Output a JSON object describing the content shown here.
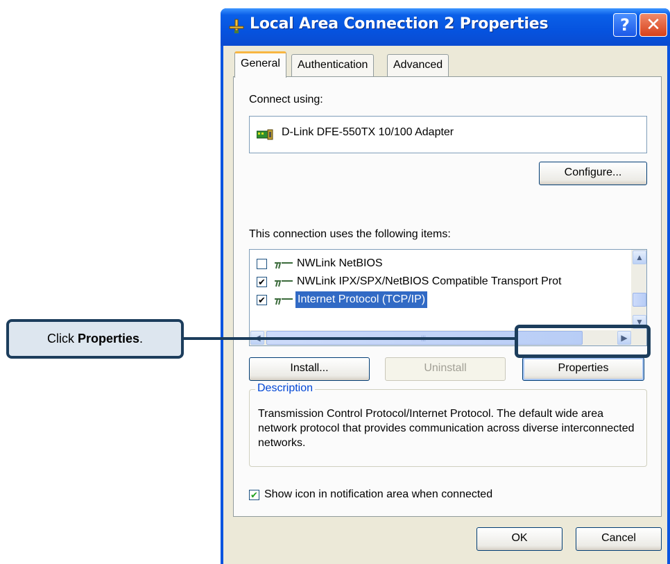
{
  "window": {
    "title": "Local Area Connection 2 Properties",
    "help_label": "?",
    "close_label": "✕"
  },
  "tabs": [
    {
      "label": "General",
      "active": true
    },
    {
      "label": "Authentication",
      "active": false
    },
    {
      "label": "Advanced",
      "active": false
    }
  ],
  "general": {
    "connect_using_label": "Connect using:",
    "adapter_name": "D-Link DFE-550TX 10/100 Adapter",
    "configure_label": "Configure...",
    "items_label": "This connection uses the following items:",
    "items": [
      {
        "label": "NWLink NetBIOS",
        "checked": false,
        "selected": false
      },
      {
        "label": "NWLink IPX/SPX/NetBIOS Compatible Transport Prot",
        "checked": true,
        "selected": false
      },
      {
        "label": "Internet Protocol (TCP/IP)",
        "checked": true,
        "selected": true
      }
    ],
    "install_label": "Install...",
    "uninstall_label": "Uninstall",
    "properties_label": "Properties",
    "description_title": "Description",
    "description_text": "Transmission Control Protocol/Internet Protocol. The default wide area network protocol that provides communication across diverse interconnected networks.",
    "show_icon_label": "Show icon in notification area when connected",
    "show_icon_checked": true
  },
  "footer": {
    "ok_label": "OK",
    "cancel_label": "Cancel"
  },
  "callout": {
    "prefix": "Click",
    "bold": "Properties",
    "suffix": "."
  },
  "colors": {
    "titlebar": "#0653df",
    "client_bg": "#ece9d8",
    "selection": "#316ac5",
    "callout_border": "#1c3d5c",
    "callout_bg": "#dde6ef",
    "group_title": "#0046d5"
  },
  "icons": {
    "title_icon": "network-connection-icon",
    "adapter_icon": "network-card-icon",
    "protocol_icon": "network-protocol-icon"
  }
}
